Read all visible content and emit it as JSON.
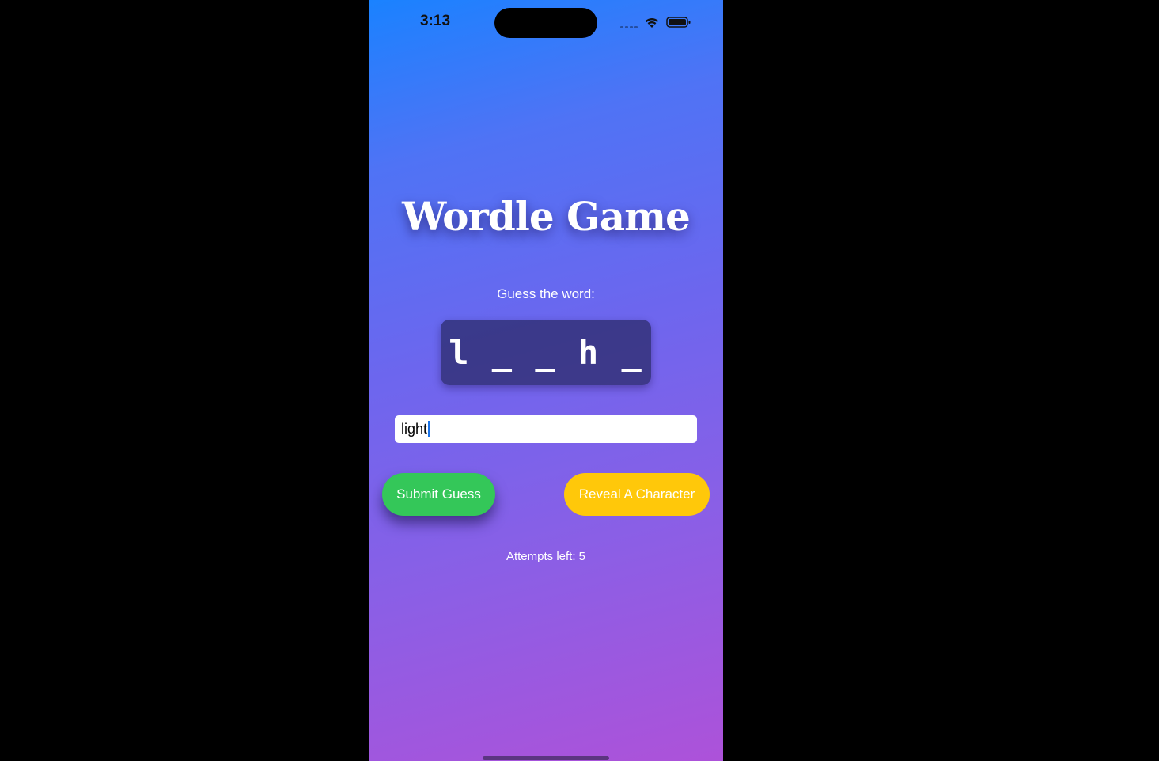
{
  "status_bar": {
    "time": "3:13"
  },
  "app": {
    "title": "Wordle Game",
    "prompt": "Guess the word:",
    "masked_word": "l _ _ h _"
  },
  "guess_input": {
    "value": "light"
  },
  "buttons": {
    "submit_label": "Submit Guess",
    "reveal_label": "Reveal A Character"
  },
  "attempts": {
    "text": "Attempts left: 5"
  },
  "colors": {
    "gradient_top": "#1a82ff",
    "gradient_bottom": "#ad52d9",
    "submit_button": "#34c759",
    "reveal_button": "#ffc80a",
    "word_box": "#282864"
  },
  "icons": [
    "signal-icon",
    "wifi-icon",
    "battery-icon"
  ]
}
